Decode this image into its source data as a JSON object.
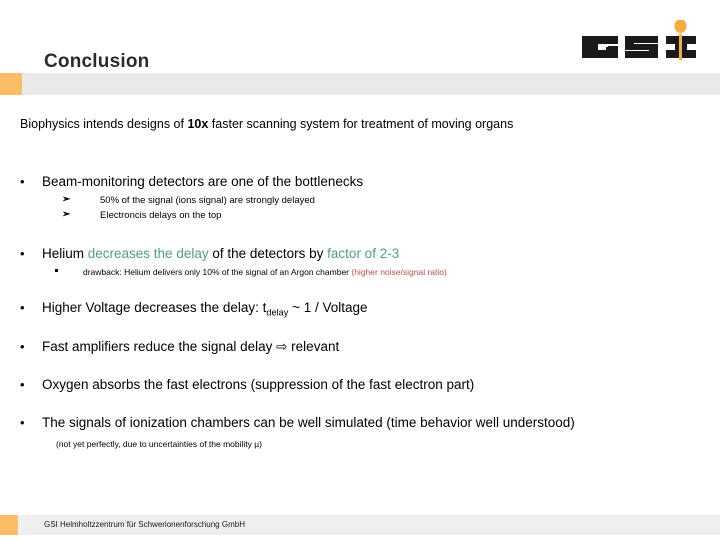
{
  "header": {
    "title": "Conclusion",
    "logo": {
      "name": "gsi-logo",
      "letters": "GSI",
      "accent_color": "#f4ae3e"
    },
    "accent_color": "#fbbd66",
    "band_color": "#e9e9e9"
  },
  "body": {
    "lead": {
      "part1": "Biophysics intends designs of ",
      "emphasis": "10x",
      "part2": " faster scanning system for treatment of moving organs"
    },
    "bullet_glyph": "•",
    "arrow_glyph": "➢",
    "bullets": [
      {
        "text": "Beam-monitoring detectors are one of the bottlenecks",
        "subs": [
          "50% of the signal (ions signal) are strongly delayed",
          "Electroncis delays on the top"
        ]
      },
      {
        "segments": [
          {
            "text": "Helium ",
            "color": "black"
          },
          {
            "text": "decreases the delay",
            "color": "teal"
          },
          {
            "text": " of the detectors by ",
            "color": "black"
          },
          {
            "text": "factor of 2-3",
            "color": "teal"
          }
        ],
        "sub_square": {
          "lead": "drawback: Helium delivers only 10%  of the signal of an Argon chamber  ",
          "highlight": "(higher noise/signal ratio)"
        }
      },
      {
        "prefix": "Higher Voltage decreases the delay:  t",
        "subscript": "delay",
        "suffix": " ~ 1 / Voltage"
      },
      {
        "text": "Fast amplifiers reduce the signal delay ⇨ relevant"
      },
      {
        "text": "Oxygen absorbs the fast electrons (suppression of the fast electron part)"
      },
      {
        "text": "The signals of ionization chambers can be well simulated  (time behavior well understood)",
        "note": "(not yet perfectly, due to uncertainties of the mobility µ)"
      }
    ],
    "colors": {
      "teal": "#4f9e82",
      "brick": "#c0504d"
    }
  },
  "footer": {
    "text": "GSI Helmholtzzentrum für Schwerionenforschung GmbH",
    "accent_color": "#fbbd66",
    "band_color": "#efefef"
  }
}
